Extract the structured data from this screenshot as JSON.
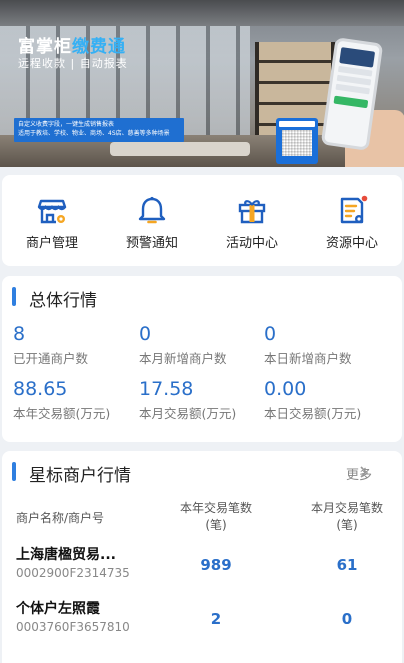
{
  "banner": {
    "brand_main": "富掌柜",
    "brand_highlight": "缴费通",
    "tagline": "远程收款 | 自动报表",
    "promo_line1": "自定义收费字段，一键生成销售报表",
    "promo_line2": "适用于教培、学校、物业、商场、4S店、慈善等多种场景"
  },
  "menu": [
    {
      "label": "商户管理",
      "icon": "store-gear-icon"
    },
    {
      "label": "预警通知",
      "icon": "bell-icon"
    },
    {
      "label": "活动中心",
      "icon": "gift-icon"
    },
    {
      "label": "资源中心",
      "icon": "document-gear-icon"
    }
  ],
  "overview": {
    "title": "总体行情",
    "stats": [
      {
        "value": "8",
        "label": "已开通商户数"
      },
      {
        "value": "0",
        "label": "本月新增商户数"
      },
      {
        "value": "0",
        "label": "本日新增商户数"
      },
      {
        "value": "88.65",
        "label": "本年交易额(万元)"
      },
      {
        "value": "17.58",
        "label": "本月交易额(万元)"
      },
      {
        "value": "0.00",
        "label": "本日交易额(万元)"
      }
    ]
  },
  "star": {
    "title": "星标商户行情",
    "more": "更多",
    "col_name": "商户名称/商户号",
    "col_year_l1": "本年交易笔数",
    "col_year_l2": "(笔)",
    "col_month_l1": "本月交易笔数",
    "col_month_l2": "(笔)",
    "rows": [
      {
        "name": "上海唐楹贸易...",
        "code": "0002900F2314735",
        "year": "989",
        "month": "61"
      },
      {
        "name": "个体户左照霞",
        "code": "0003760F3657810",
        "year": "2",
        "month": "0"
      }
    ]
  },
  "colors": {
    "accent": "#2f7fe0",
    "value": "#2a6fc9",
    "background": "#eef1f5"
  }
}
